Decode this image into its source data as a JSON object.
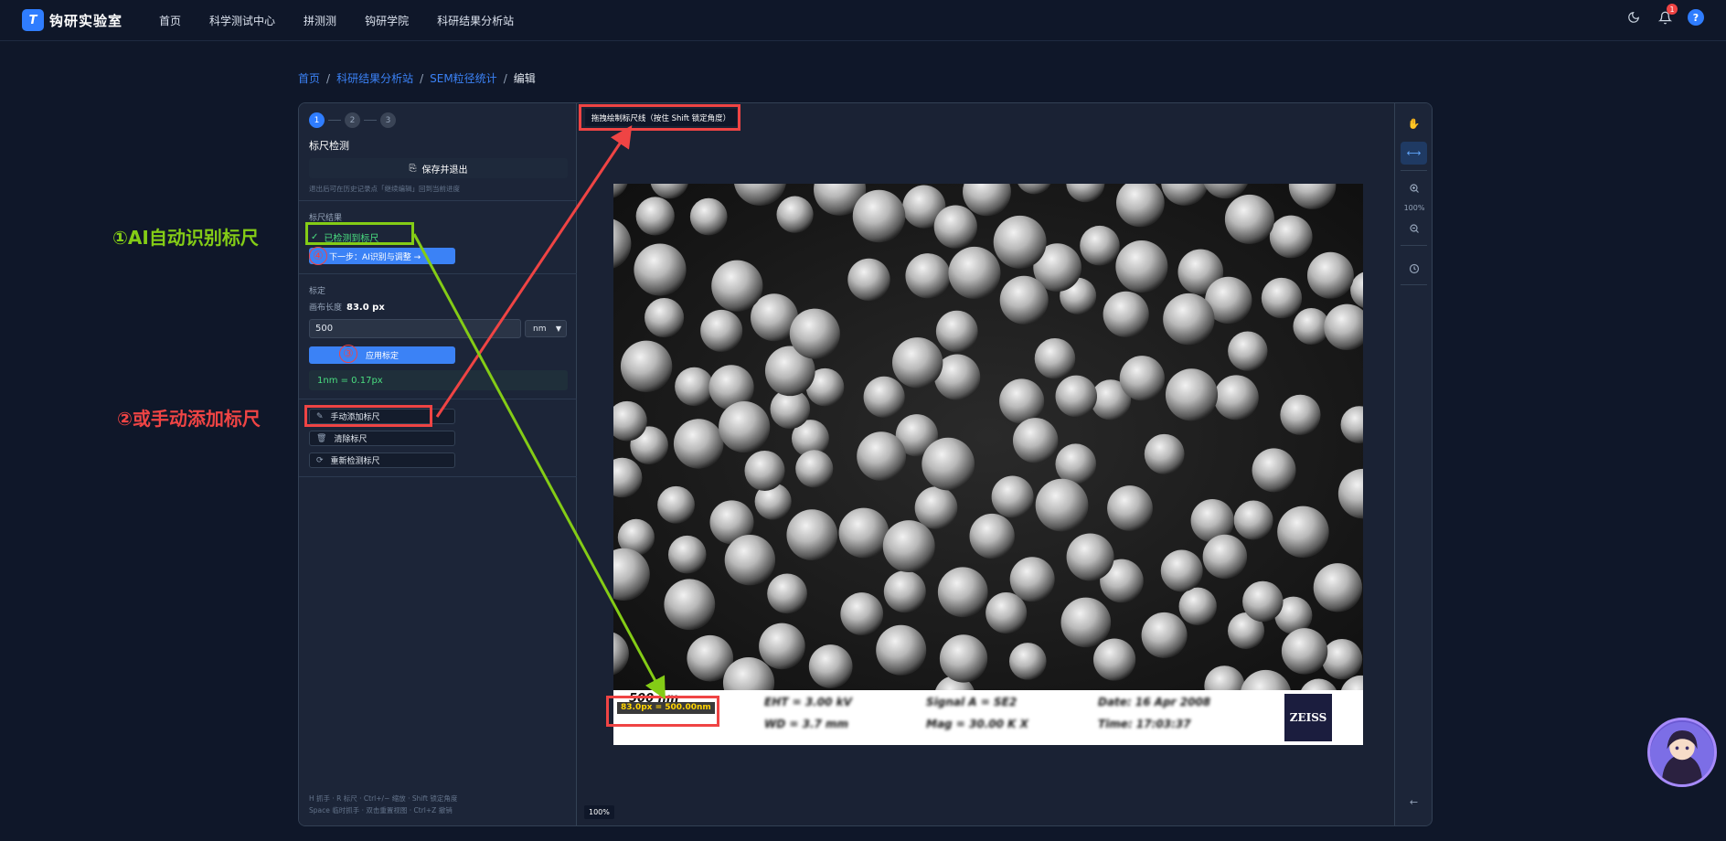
{
  "app": {
    "title": "钩研实验室",
    "logo_mark": "T"
  },
  "nav": [
    "首页",
    "科学测试中心",
    "拼测测",
    "钩研学院",
    "科研结果分析站"
  ],
  "top_icons": {
    "notifications_count": "1",
    "help": "?"
  },
  "breadcrumb": [
    "首页",
    "科研结果分析站",
    "SEM粒径统计",
    "编辑"
  ],
  "steps": [
    "1",
    "2",
    "3"
  ],
  "left": {
    "title": "标尺检测",
    "save_button": "保存并退出",
    "save_hint": "退出后可在历史记录点「继续编辑」回到当前进度",
    "scale_result_label": "标尺结果",
    "detected": "已检测到标尺",
    "next_button": "下一步：AI识别与调整 →",
    "calibration_label": "标定",
    "canvas_length_label": "画布长度",
    "canvas_length_value": "83.0 px",
    "length_input": "500",
    "unit": "nm",
    "apply_button": "应用标定",
    "ratio": "1nm = 0.17px",
    "manual_add": "手动添加标尺",
    "clear": "清除标尺",
    "redetect": "重新检测标尺",
    "shortcuts_line1": "H 抓手 · R 标尺 · Ctrl+/− 缩放 · Shift 锁定角度",
    "shortcuts_line2": "Space 临时抓手 · 双击重置视图 · Ctrl+Z 撤销"
  },
  "canvas": {
    "hint": "拖拽绘制标尺线（按住 Shift 锁定角度）",
    "scale_bar_text": "500 nm",
    "scale_tag": "83.0px = 500.00nm",
    "brand": "ZEISS",
    "zoom": "100%"
  },
  "right_bar": {
    "zoom": "100%"
  },
  "annotations": {
    "green": "①AI自动识别标尺",
    "red": "②或手动添加标尺",
    "circle3": "③",
    "circle4": "④"
  },
  "colors": {
    "accent": "#2f7dff",
    "success": "#4ade80",
    "annotation_red": "#ef4444",
    "annotation_green": "#84cc16"
  }
}
